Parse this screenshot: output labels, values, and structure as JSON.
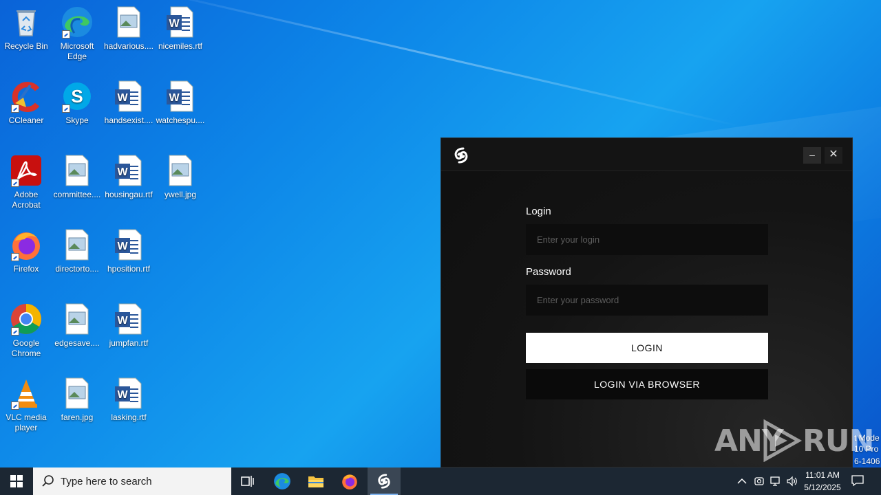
{
  "desktop": {
    "icons": [
      {
        "label": "Recycle Bin",
        "icon": "recycle-bin-icon"
      },
      {
        "label": "Microsoft Edge",
        "icon": "edge-icon"
      },
      {
        "label": "hadvarious....",
        "icon": "image-file-icon"
      },
      {
        "label": "nicemiles.rtf",
        "icon": "word-document-icon"
      },
      {
        "label": "CCleaner",
        "icon": "ccleaner-icon"
      },
      {
        "label": "Skype",
        "icon": "skype-icon"
      },
      {
        "label": "handsexist....",
        "icon": "word-document-icon"
      },
      {
        "label": "watchespu....",
        "icon": "word-document-icon"
      },
      {
        "label": "Adobe Acrobat",
        "icon": "acrobat-icon"
      },
      {
        "label": "committee....",
        "icon": "image-file-icon"
      },
      {
        "label": "housingau.rtf",
        "icon": "word-document-icon"
      },
      {
        "label": "ywell.jpg",
        "icon": "image-file-icon"
      },
      {
        "label": "Firefox",
        "icon": "firefox-icon"
      },
      {
        "label": "directorto....",
        "icon": "image-file-icon"
      },
      {
        "label": "hposition.rtf",
        "icon": "word-document-icon"
      },
      {
        "label": "Google Chrome",
        "icon": "chrome-icon"
      },
      {
        "label": "edgesave....",
        "icon": "image-file-icon"
      },
      {
        "label": "jumpfan.rtf",
        "icon": "word-document-icon"
      },
      {
        "label": "VLC media player",
        "icon": "vlc-icon"
      },
      {
        "label": "faren.jpg",
        "icon": "image-file-icon"
      },
      {
        "label": "lasking.rtf",
        "icon": "word-document-icon"
      }
    ],
    "edition_lines": [
      "t Mode",
      "10 Pro",
      "6-1406"
    ],
    "watermark": {
      "left": "ANY",
      "right": "RUN"
    }
  },
  "app": {
    "minimize_label": "–",
    "close_label": "✕",
    "login_label": "Login",
    "login_placeholder": "Enter your login",
    "login_value": "",
    "password_label": "Password",
    "password_placeholder": "Enter your password",
    "password_value": "",
    "login_button": "LOGIN",
    "browser_button": "LOGIN VIA BROWSER"
  },
  "taskbar": {
    "search_placeholder": "Type here to search",
    "clock_time": "11:01 AM",
    "clock_date": "5/12/2025"
  },
  "colors": {
    "desktop_blue": "#0d86e8",
    "taskbar": "#1c2733",
    "app_bg": "#141414",
    "login_button": "#ffffff"
  }
}
